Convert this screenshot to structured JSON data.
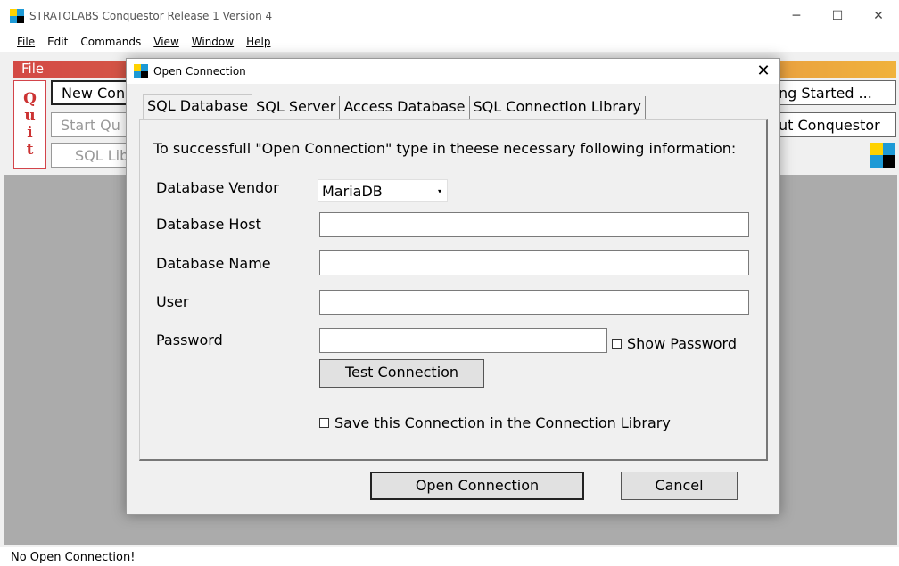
{
  "app": {
    "title": "STRATOLABS Conquestor Release 1 Version 4",
    "window_controls": {
      "minimize": "─",
      "maximize": "☐",
      "close": "✕"
    }
  },
  "menu": [
    {
      "label": "File"
    },
    {
      "label": "Edit"
    },
    {
      "label": "Commands"
    },
    {
      "label": "View"
    },
    {
      "label": "Window"
    },
    {
      "label": "Help"
    }
  ],
  "toolbar": {
    "file_header": "File",
    "quit_letters": [
      "Q",
      "u",
      "i",
      "t"
    ],
    "new_connection": "New Conn",
    "start_query": "Start Qu",
    "sql_library": "SQL Lib",
    "getting_started": "ng Started ...",
    "about": "ut Conquestor"
  },
  "status": "No Open Connection!",
  "dialog": {
    "title": "Open Connection",
    "close_glyph": "✕",
    "tabs": [
      {
        "label": "SQL Database",
        "active": true
      },
      {
        "label": "SQL Server",
        "active": false
      },
      {
        "label": "Access Database",
        "active": false
      },
      {
        "label": "SQL Connection Library",
        "active": false
      }
    ],
    "intro": "To successfull \"Open Connection\" type in theese necessary following information:",
    "fields": {
      "vendor_label": "Database Vendor",
      "vendor_value": "MariaDB",
      "host_label": "Database Host",
      "host_value": "",
      "name_label": "Database Name",
      "name_value": "",
      "user_label": "User",
      "user_value": "",
      "password_label": "Password",
      "password_value": ""
    },
    "show_password_label": "Show Password",
    "test_connection_label": "Test Connection",
    "save_connection_label": "Save this Connection in the Connection Library",
    "open_connection_label": "Open Connection",
    "cancel_label": "Cancel"
  },
  "icons": {
    "dropdown": "▾"
  },
  "colors": {
    "quit_red": "#cc3333",
    "header_gradient_start": "#d34a45",
    "header_gradient_end": "#f0b23c",
    "logo_yellow": "#ffd200",
    "logo_blue": "#1e9ad6",
    "workspace_gray": "#ababab"
  }
}
